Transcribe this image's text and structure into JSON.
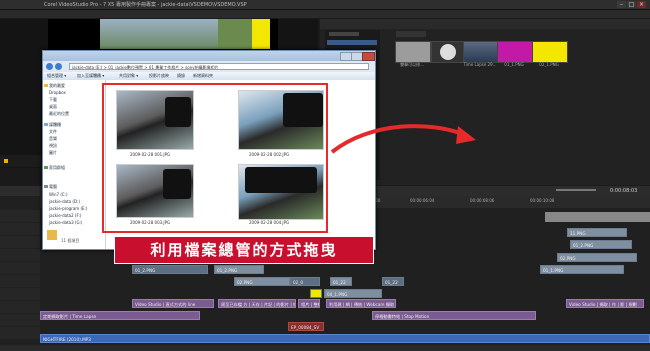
{
  "window": {
    "title": "Corel VideoStudio Pro - 7 X5 專用製作手冊專案 - jackie-data\\VSDEMO\\VSDEMO.VSP"
  },
  "explorer": {
    "address": "jackie-data (E:) > 01_jackie數位預覽 > 01 專業工作相片 > sony拍攝影像相片",
    "toolbar": [
      "組合管理 ▾",
      "加入至媒體櫃 ▾",
      "共用對象 ▾",
      "投影片放映",
      "燒錄",
      "新增資料夾"
    ],
    "nav": [
      "我的最愛",
      "Dropbox",
      "下載",
      "桌面",
      "最近的位置",
      "媒體櫃",
      "文件",
      "音樂",
      "視訊",
      "圖片",
      "家用群組",
      "電腦",
      "Win7 (C:)",
      "jackie-data (D:)",
      "jackie-program (E:)",
      "jackie-data2 (F:)",
      "jackie-data3 (G:)"
    ],
    "item_count": "11 個項目",
    "files": [
      "2009-02-28 001.JPG",
      "2009-02-28 002.JPG",
      "2009-02-28 003.JPG",
      "2009-02-28 004.JPG"
    ]
  },
  "caption": "利用檔案總管的方式拖曳",
  "library": {
    "thumbs": [
      "雙擊可以修...",
      "",
      "Time Lapse 29...",
      "01_1.PNG",
      "02_1.PNG"
    ]
  },
  "timeline": {
    "timecode": "0:00:08:03",
    "ruler": [
      "00:00:04:00",
      "00:00:06:04",
      "00:00:08:06",
      "00:00:10:08"
    ],
    "clips": {
      "c1": "11.PNG",
      "c2": "01_2.PNG",
      "c3": "02.PNG",
      "c4": "01_1.PNG",
      "c5": "01_2.PNG",
      "c6": "01_2.PNG",
      "c7": "02.PNG",
      "c8": "02_0",
      "c9": "01_22",
      "c10": "01_22",
      "c11": "04_1.PNG",
      "c12": "Video Studio | 直式方式的 line",
      "c13": "周至已存檔 方 | 天存 | 片記 | 的影片 | 相同",
      "c14": "相片 | 整網",
      "c15": "利用建 | 網 | 傳統 | Webcam 擷取 | 影 | 相機",
      "c16": "Video Studio | 擷取 | 作 | 影 | 規劃",
      "c17": "定期擷取影片 | Time Lapse",
      "c18": "停格動畫特效 | Stop Motion",
      "c19": "EP_00084_SV",
      "c20": "NIGHTFIRE (2010).MP3",
      "c21": "EP_00001"
    }
  },
  "colors": {
    "caption_bg": "#c8102e",
    "highlight": "#e42a2a",
    "accent_yellow": "#f3e600",
    "accent_magenta": "#c21aa6"
  }
}
